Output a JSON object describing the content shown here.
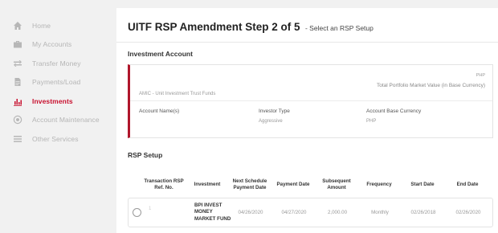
{
  "sidebar": {
    "items": [
      {
        "label": "Home",
        "icon": "home-icon"
      },
      {
        "label": "My Accounts",
        "icon": "briefcase-icon"
      },
      {
        "label": "Transfer Money",
        "icon": "transfer-icon"
      },
      {
        "label": "Payments/Load",
        "icon": "document-icon"
      },
      {
        "label": "Investments",
        "icon": "bar-chart-icon",
        "active": true
      },
      {
        "label": "Account Maintenance",
        "icon": "settings-icon"
      },
      {
        "label": "Other Services",
        "icon": "list-icon"
      }
    ],
    "active_color": "#c8102e"
  },
  "header": {
    "title": "UITF RSP Amendment Step 2 of 5",
    "subtitle": "- Select an RSP Setup"
  },
  "investment_account": {
    "heading": "Investment Account",
    "fund_name": "AMIC - Unit Investment Trust Funds",
    "currency_code": "PHP",
    "tpmv_label": "Total Portfolio Market Value (in Base Currency)",
    "fields": [
      {
        "label": "Account Name(s)",
        "value": ""
      },
      {
        "label": "Investor Type",
        "value": "Aggressive"
      },
      {
        "label": "Account Base Currency",
        "value": "PHP"
      }
    ],
    "accent_color": "#b0162b"
  },
  "rsp_setup": {
    "heading": "RSP Setup",
    "columns": [
      "Transaction RSP Ref. No.",
      "Investment",
      "Next Schedule Payment Date",
      "Payment Date",
      "Subsequent Amount",
      "Frequency",
      "Start Date",
      "End Date"
    ],
    "rows": [
      {
        "ref_no": "1",
        "investment": "BPI INVEST MONEY MARKET FUND",
        "next_payment_date": "04/26/2020",
        "payment_date": "04/27/2020",
        "subsequent_amount": "2,000.00",
        "frequency": "Monthly",
        "start_date": "02/26/2018",
        "end_date": "02/26/2020"
      }
    ]
  }
}
